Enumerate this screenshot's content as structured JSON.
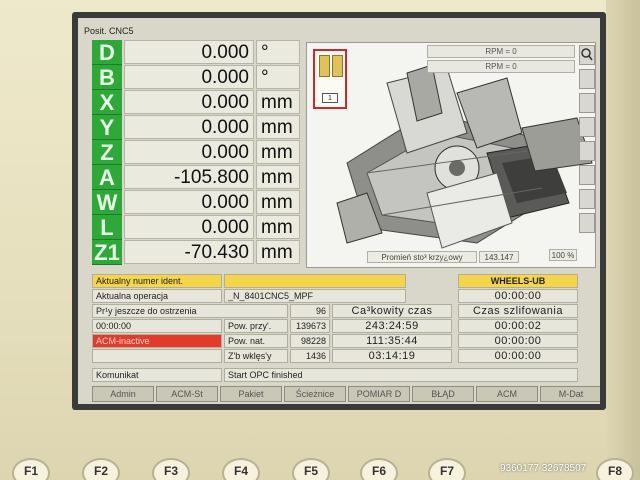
{
  "window_title": "Posit. CNC5",
  "axes": [
    {
      "letter": "D",
      "value": "0.000",
      "unit": "°"
    },
    {
      "letter": "B",
      "value": "0.000",
      "unit": "°"
    },
    {
      "letter": "X",
      "value": "0.000",
      "unit": "mm"
    },
    {
      "letter": "Y",
      "value": "0.000",
      "unit": "mm"
    },
    {
      "letter": "Z",
      "value": "0.000",
      "unit": "mm"
    },
    {
      "letter": "A",
      "value": "-105.800",
      "unit": "mm"
    },
    {
      "letter": "W",
      "value": "0.000",
      "unit": "mm"
    },
    {
      "letter": "L",
      "value": "0.000",
      "unit": "mm"
    },
    {
      "letter": "Z1",
      "value": "-70.430",
      "unit": "mm"
    }
  ],
  "view": {
    "rpm_1": "RPM = 0",
    "rpm_2": "RPM = 0",
    "tool_number": "1",
    "radius_label": "Promień sto³ krzy¿owy",
    "radius_value": "143.147",
    "zoom": "100 %"
  },
  "table": {
    "current_ident_label": "Aktualny numer ident.",
    "current_ident_value": "",
    "current_op_label": "Aktualna operacja",
    "current_op_value": "_N_8401CNC5_MPF",
    "remaining_label": "Pr¹y jeszcze do ostrzenia",
    "remaining_value": "96",
    "time_label": "00:00:00",
    "acm_status": "ACM-inactive",
    "total_time_header": "Ca³kowity czas",
    "grind_time_header": "Czas szlifowania",
    "wheels_header": "WHEELS-UB",
    "wheels_time": "00:00:00",
    "rows": [
      {
        "label": "Pow. przy'.",
        "count": "139673",
        "total": "243:24:59",
        "grind": "00:00:02"
      },
      {
        "label": "Pow. nat.",
        "count": "98228",
        "total": "111:35:44",
        "grind": "00:00:00"
      },
      {
        "label": "Z'b wklęs'y",
        "count": "1436",
        "total": "03:14:19",
        "grind": "00:00:00"
      }
    ],
    "message_label": "Komunikat",
    "message_value": "Start OPC finished"
  },
  "softkeys": [
    "Admin",
    "ACM-St",
    "Pakiet",
    "Ścieżnice",
    "POMIAR D",
    "BŁĄD",
    "ACM",
    "M-Dat"
  ],
  "hardware_keys": [
    "F1",
    "F2",
    "F3",
    "F4",
    "F5",
    "F6",
    "F7",
    "F8"
  ],
  "watermark": "9360177 32678507",
  "colors": {
    "axis_green": "#2fa83a",
    "highlight_yellow": "#f5d54a",
    "alarm_red": "#e33a2a"
  }
}
